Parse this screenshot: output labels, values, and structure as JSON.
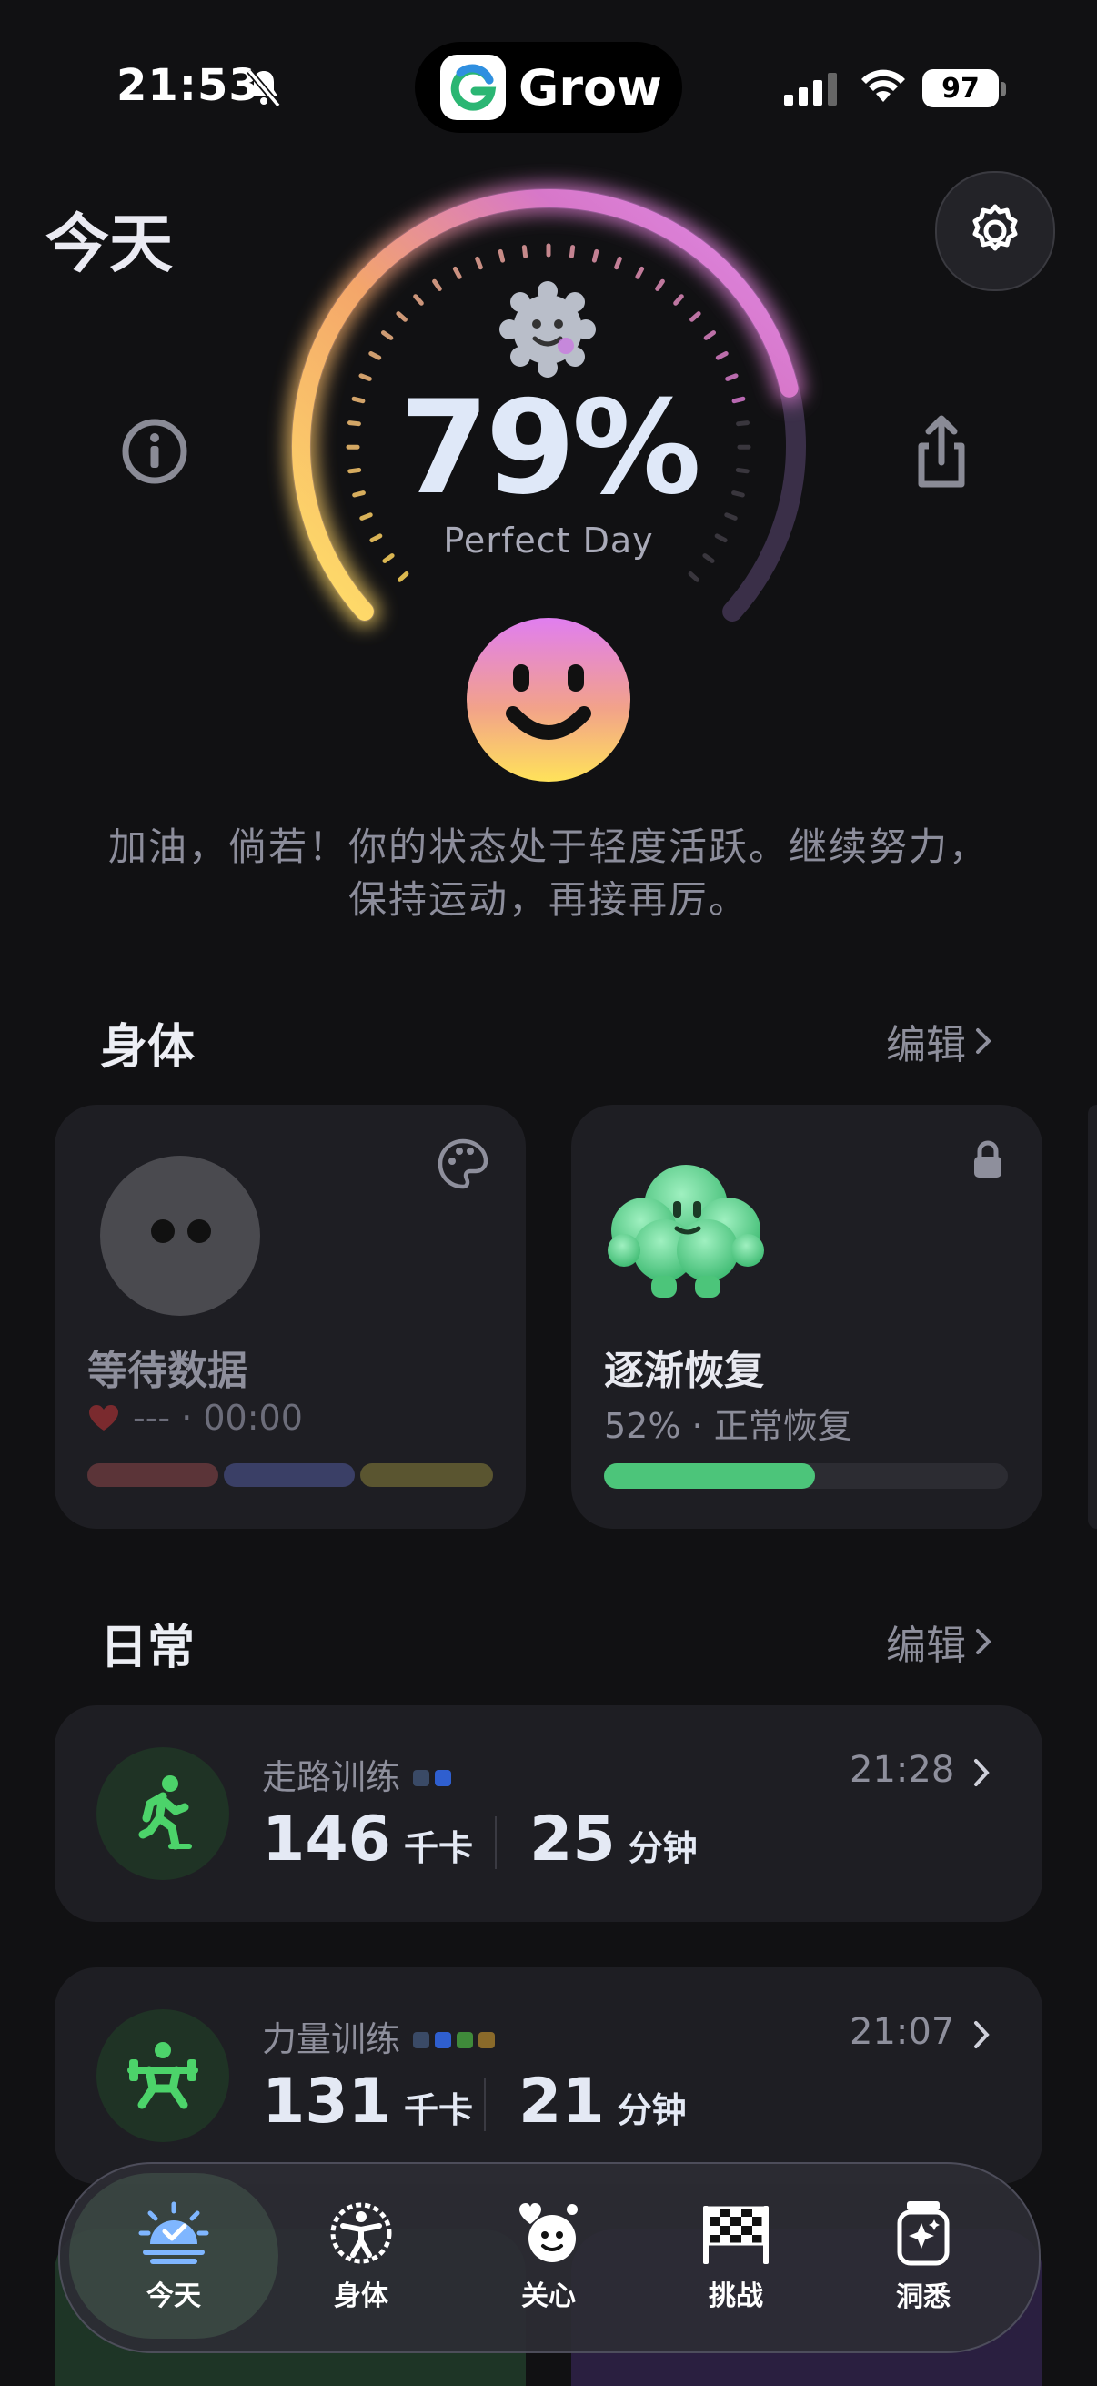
{
  "status_bar": {
    "time": "21:53",
    "battery": "97"
  },
  "app": {
    "name": "Grow"
  },
  "header": {
    "title": "今天"
  },
  "gauge": {
    "percent": "79%",
    "label": "Perfect Day",
    "value": 0.79
  },
  "message": "加油，倘若！你的状态处于轻度活跃。继续努力，保持运动，再接再厉。",
  "body_section": {
    "title": "身体",
    "edit_label": "编辑",
    "cards": [
      {
        "title": "等待数据",
        "subtitle": "--- · 00:00"
      },
      {
        "title": "逐渐恢复",
        "subtitle": "52% · 正常恢复",
        "progress": 0.52
      }
    ]
  },
  "daily_section": {
    "title": "日常",
    "edit_label": "编辑",
    "activities": [
      {
        "name": "走路训练",
        "calories": "146",
        "calories_unit": "千卡",
        "minutes": "25",
        "minutes_unit": "分钟",
        "time": "21:28"
      },
      {
        "name": "力量训练",
        "calories": "131",
        "calories_unit": "千卡",
        "minutes": "21",
        "minutes_unit": "分钟",
        "time": "21:07"
      }
    ]
  },
  "tabs": [
    {
      "label": "今天",
      "active": true
    },
    {
      "label": "身体"
    },
    {
      "label": "关心"
    },
    {
      "label": "挑战"
    },
    {
      "label": "洞悉"
    }
  ],
  "colors": {
    "background": "#111113",
    "card": "#1e1e23",
    "accent_green": "#4cc57a",
    "gauge_start": "#ffd85a",
    "gauge_end": "#e08be8"
  }
}
